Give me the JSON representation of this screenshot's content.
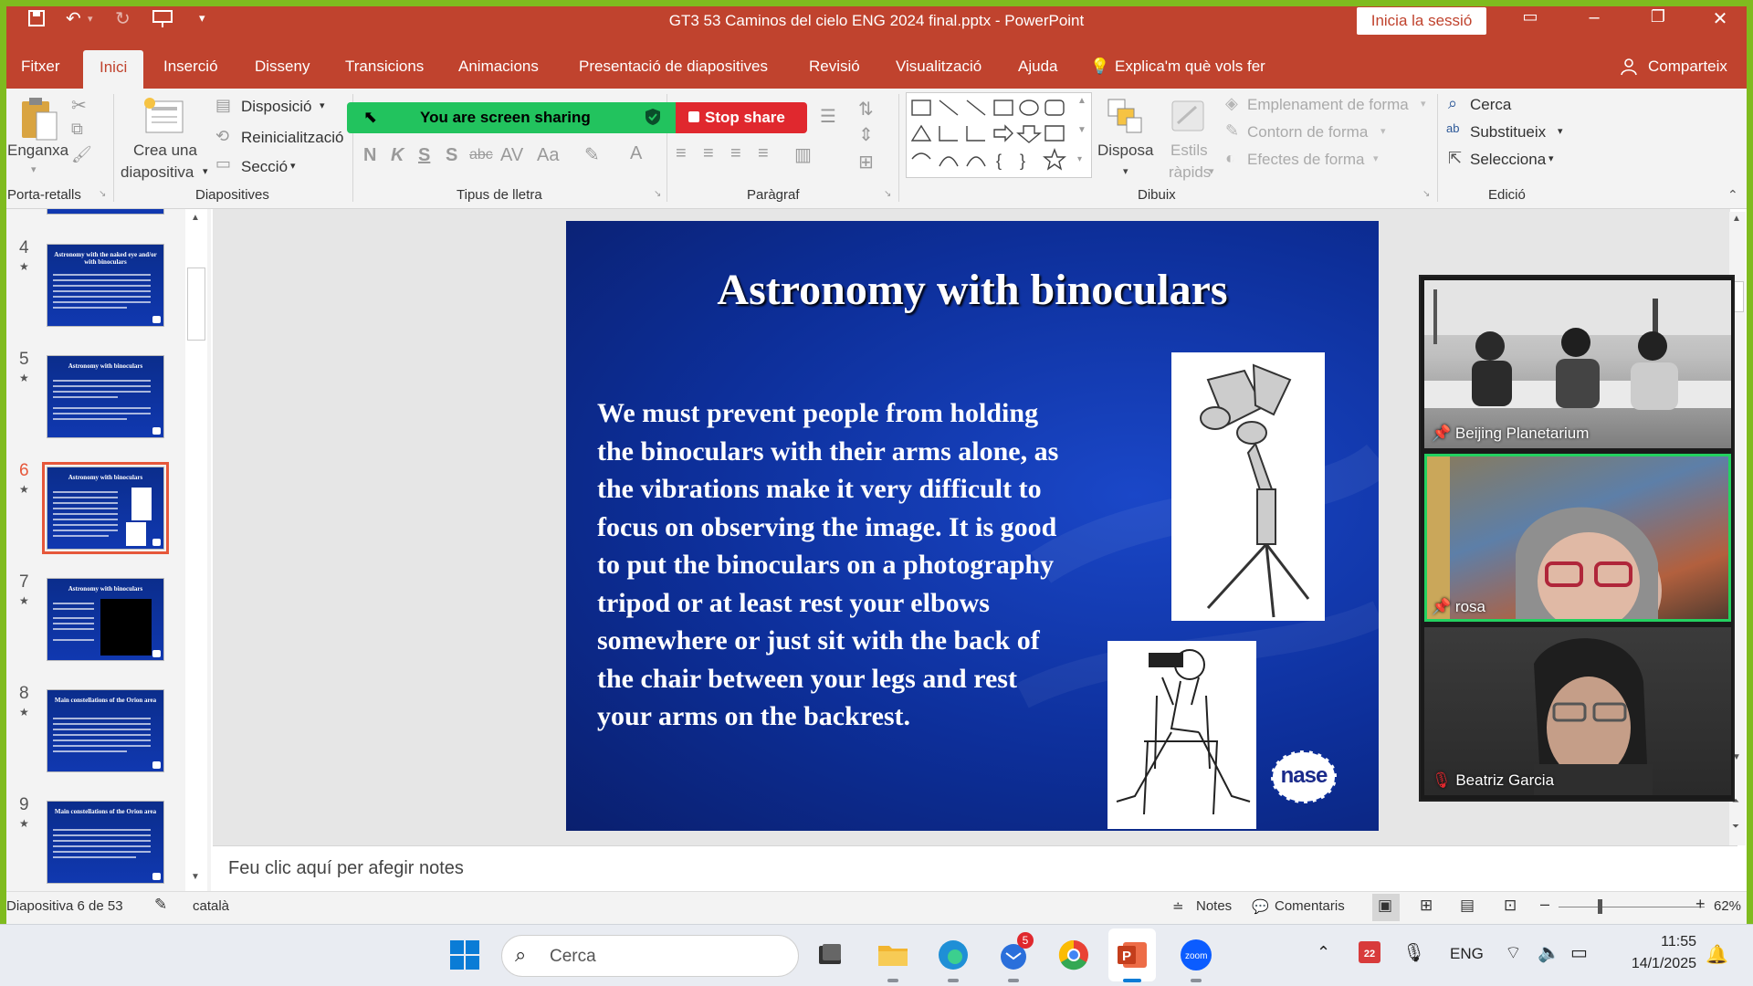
{
  "titlebar": {
    "title": "GT3 53 Caminos del cielo ENG 2024 final.pptx  -  PowerPoint",
    "signin": "Inicia la sessió",
    "icons": [
      "save-icon",
      "undo-icon",
      "redo-icon",
      "presenter-icon",
      "customize-icon"
    ]
  },
  "tabs": [
    "Fitxer",
    "Inici",
    "Inserció",
    "Disseny",
    "Transicions",
    "Animacions",
    "Presentació de diapositives",
    "Revisió",
    "Visualització",
    "Ajuda"
  ],
  "tell_me": "Explica'm què vols fer",
  "share_btn": "Comparteix",
  "ribbon": {
    "clipboard": {
      "paste": "Enganxa",
      "group": "Porta-retalls"
    },
    "slides": {
      "new_slide_1": "Crea una",
      "new_slide_2": "diapositiva",
      "layout": "Disposició",
      "reset": "Reinicialització",
      "section": "Secció",
      "group": "Diapositives"
    },
    "font": {
      "group": "Tipus de lletra",
      "bold": "N",
      "italic": "K",
      "underline": "S",
      "shadow": "S",
      "strike": "abc",
      "spacing": "AV",
      "case": "Aa"
    },
    "paragraph": {
      "group": "Paràgraf"
    },
    "drawing": {
      "arrange": "Disposa",
      "quick_styles_1": "Estils",
      "quick_styles_2": "ràpids",
      "fill": "Emplenament de forma",
      "outline": "Contorn de forma",
      "effects": "Efectes de forma",
      "group": "Dibuix"
    },
    "editing": {
      "find": "Cerca",
      "replace": "Substitueix",
      "select": "Selecciona",
      "group": "Edició"
    }
  },
  "screenshare": {
    "status": "You are screen sharing",
    "stop": "Stop share"
  },
  "thumbnails": [
    {
      "num": "4",
      "title": "Astronomy with the naked eye and/or with binoculars",
      "selected": false
    },
    {
      "num": "5",
      "title": "Astronomy with binoculars",
      "selected": false
    },
    {
      "num": "6",
      "title": "Astronomy with binoculars",
      "selected": true
    },
    {
      "num": "7",
      "title": "Astronomy with binoculars",
      "selected": false
    },
    {
      "num": "8",
      "title": "Main constellations of the Orion area",
      "selected": false
    },
    {
      "num": "9",
      "title": "Main constellations of the Orion area",
      "selected": false
    }
  ],
  "slide": {
    "title": "Astronomy with binoculars",
    "body": "We must prevent people from holding the binoculars with their arms alone, as the vibrations make it very difficult to focus on observing the image. It is good to put the binoculars on a photography tripod or at least rest your elbows somewhere or just sit with the back of the chair between your legs and rest your arms on the backrest.",
    "logo": "nase"
  },
  "participants": [
    {
      "name": "Beijing Planetarium",
      "muted": false,
      "pinned": true
    },
    {
      "name": "rosa",
      "muted": false,
      "pinned": true,
      "active_speaker": true
    },
    {
      "name": "Beatriz Garcia",
      "muted": true,
      "pinned": false
    }
  ],
  "notes_placeholder": "Feu clic aquí per afegir notes",
  "statusbar": {
    "slide": "Diapositiva 6 de 53",
    "language": "català",
    "notes": "Notes",
    "comments": "Comentaris",
    "zoom": "62%"
  },
  "taskbar": {
    "search": "Cerca",
    "lang": "ENG",
    "time": "11:55",
    "date": "14/1/2025",
    "badge_count": "5",
    "calendar_day": "22",
    "apps": [
      "start-icon",
      "taskview-icon",
      "file-explorer-icon",
      "edge-icon",
      "email-icon",
      "chrome-icon",
      "powerpoint-icon",
      "zoom-icon"
    ]
  },
  "colors": {
    "accent": "#c0432e",
    "frame": "#7fbb1f",
    "slide_bg": "#0d2f9a",
    "share_green": "#22c35e",
    "stop_red": "#e0282e"
  }
}
